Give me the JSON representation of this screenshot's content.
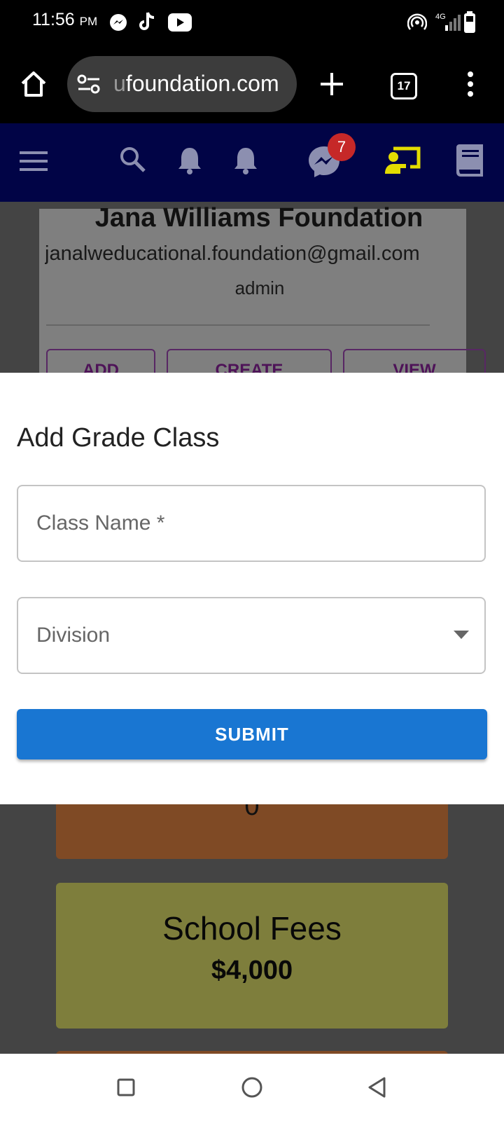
{
  "status_bar": {
    "time": "11:56",
    "ampm": "PM",
    "network": "4G"
  },
  "browser": {
    "url_faded": "u",
    "url_main": "foundation.com",
    "tab_count": "17"
  },
  "app_header": {
    "message_badge": "7",
    "accent_color": "#e3dc00"
  },
  "background": {
    "org_name": "Jana Williams Foundation",
    "email": "janalweducational.foundation@gmail.com",
    "role": "admin",
    "buttons": [
      "ADD",
      "CREATE",
      "VIEW"
    ],
    "stat_value": "0",
    "fees_title": "School Fees",
    "fees_amount": "$4,000"
  },
  "dialog": {
    "title": "Add Grade Class",
    "class_name_label": "Class Name *",
    "division_label": "Division",
    "submit_label": "SUBMIT"
  },
  "colors": {
    "header_bg": "#010446",
    "submit_bg": "#1976d2",
    "badge_bg": "#c62828"
  }
}
